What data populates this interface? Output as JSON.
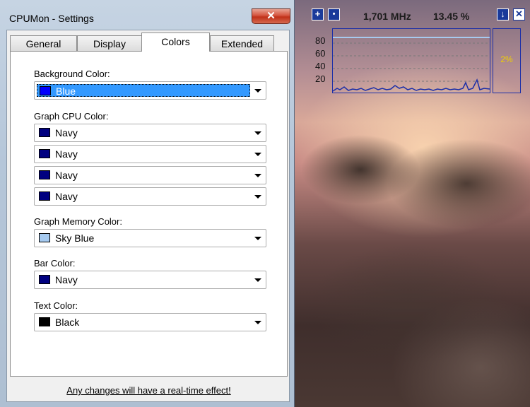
{
  "window": {
    "title": "CPUMon - Settings",
    "close_label": "✕",
    "tabs": [
      {
        "label": "General"
      },
      {
        "label": "Display"
      },
      {
        "label": "Colors"
      },
      {
        "label": "Extended"
      }
    ],
    "active_tab": "Colors",
    "sections": {
      "background": {
        "label": "Background Color:",
        "value": "Blue",
        "swatch": "#0000ff"
      },
      "graph_cpu": {
        "label": "Graph CPU Color:",
        "items": [
          {
            "value": "Navy",
            "swatch": "#000080"
          },
          {
            "value": "Navy",
            "swatch": "#000080"
          },
          {
            "value": "Navy",
            "swatch": "#000080"
          },
          {
            "value": "Navy",
            "swatch": "#000080"
          }
        ]
      },
      "graph_memory": {
        "label": "Graph Memory Color:",
        "value": "Sky Blue",
        "swatch": "#a6caf0"
      },
      "bar": {
        "label": "Bar Color:",
        "value": "Navy",
        "swatch": "#000080"
      },
      "text": {
        "label": "Text Color:",
        "value": "Black",
        "swatch": "#000000"
      }
    },
    "footer_link": "Any changes will have a real-time effect!"
  },
  "monitor": {
    "frequency": "1,701 MHz",
    "cpu_percent": "13.45 %",
    "bar_percent": "2%",
    "y_ticks": [
      "80",
      "60",
      "40",
      "20"
    ],
    "buttons": {
      "add": "+",
      "pin": "•",
      "down": "↓",
      "close": "✕"
    },
    "colors": {
      "graph_line": "#1b2ea8",
      "memory_line": "#a6caf0",
      "bar_text": "#f0d000"
    }
  }
}
